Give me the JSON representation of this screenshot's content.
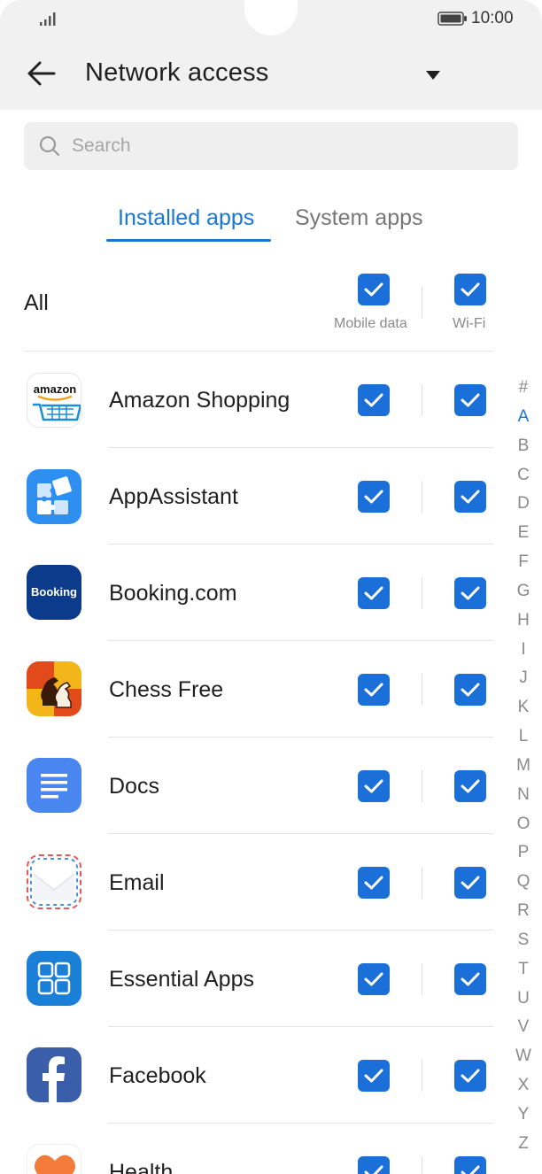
{
  "status_bar": {
    "time": "10:00"
  },
  "header": {
    "title": "Network access"
  },
  "search": {
    "placeholder": "Search"
  },
  "tabs": [
    {
      "label": "Installed apps",
      "active": true
    },
    {
      "label": "System apps",
      "active": false
    }
  ],
  "all_row": {
    "label": "All",
    "mobile_data_label": "Mobile data",
    "wifi_label": "Wi-Fi",
    "mobile_data_checked": true,
    "wifi_checked": true
  },
  "apps": [
    {
      "name": "Amazon Shopping",
      "icon": "amazon-icon",
      "mobile_data": true,
      "wifi": true
    },
    {
      "name": "AppAssistant",
      "icon": "puzzle-icon",
      "mobile_data": true,
      "wifi": true
    },
    {
      "name": "Booking.com",
      "icon": "booking-icon",
      "mobile_data": true,
      "wifi": true
    },
    {
      "name": "Chess Free",
      "icon": "chess-icon",
      "mobile_data": true,
      "wifi": true
    },
    {
      "name": "Docs",
      "icon": "docs-icon",
      "mobile_data": true,
      "wifi": true
    },
    {
      "name": "Email",
      "icon": "email-icon",
      "mobile_data": true,
      "wifi": true
    },
    {
      "name": "Essential Apps",
      "icon": "essential-apps-icon",
      "mobile_data": true,
      "wifi": true
    },
    {
      "name": "Facebook",
      "icon": "facebook-icon",
      "mobile_data": true,
      "wifi": true
    },
    {
      "name": "Health",
      "icon": "health-icon",
      "mobile_data": true,
      "wifi": true
    }
  ],
  "icon_labels": {
    "amazon": "amazon",
    "booking": "Booking"
  },
  "index_letters": [
    "#",
    "A",
    "B",
    "C",
    "D",
    "E",
    "F",
    "G",
    "H",
    "I",
    "J",
    "K",
    "L",
    "M",
    "N",
    "O",
    "P",
    "Q",
    "R",
    "S",
    "T",
    "U",
    "V",
    "W",
    "X",
    "Y",
    "Z"
  ],
  "index_active": "A",
  "colors": {
    "accent": "#1976d2",
    "checkbox": "#1b6fd8",
    "header_bg": "#f1f1f1"
  }
}
